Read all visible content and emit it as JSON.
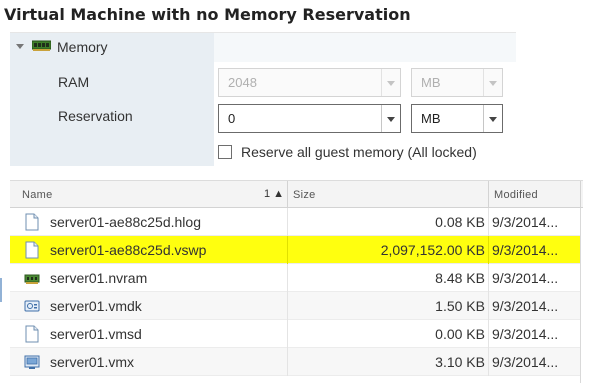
{
  "title": "Virtual Machine with no Memory Reservation",
  "memory_panel": {
    "section_label": "Memory",
    "section_icon": "memory-chip-icon",
    "ram": {
      "label": "RAM",
      "value": "2048",
      "unit": "MB",
      "disabled": true
    },
    "reservation": {
      "label": "Reservation",
      "value": "0",
      "unit": "MB",
      "disabled": false
    },
    "reserve_all": {
      "label": "Reserve all guest memory (All locked)",
      "checked": false
    }
  },
  "file_table": {
    "columns": {
      "name": "Name",
      "sort_indicator": "1 ▲",
      "size": "Size",
      "modified": "Modified"
    },
    "rows": [
      {
        "name": "server01-ae88c25d.hlog",
        "size": "0.08 KB",
        "modified": "9/3/2014...",
        "icon": "file-icon",
        "highlighted": false
      },
      {
        "name": "server01-ae88c25d.vswp",
        "size": "2,097,152.00 KB",
        "modified": "9/3/2014...",
        "icon": "file-icon",
        "highlighted": true
      },
      {
        "name": "server01.nvram",
        "size": "8.48 KB",
        "modified": "9/3/2014...",
        "icon": "nvram-chip-icon",
        "highlighted": false
      },
      {
        "name": "server01.vmdk",
        "size": "1.50 KB",
        "modified": "9/3/2014...",
        "icon": "virtual-disk-icon",
        "highlighted": false
      },
      {
        "name": "server01.vmsd",
        "size": "0.00 KB",
        "modified": "9/3/2014...",
        "icon": "file-icon",
        "highlighted": false
      },
      {
        "name": "server01.vmx",
        "size": "3.10 KB",
        "modified": "9/3/2014...",
        "icon": "vm-config-icon",
        "highlighted": false
      }
    ]
  },
  "colors": {
    "highlight": "#ffff0f",
    "panel_left": "#e8eef3",
    "accent": "#4a7ebb"
  }
}
